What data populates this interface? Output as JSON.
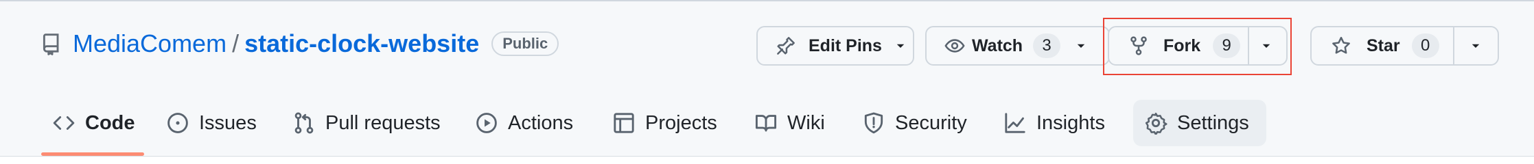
{
  "repo": {
    "owner": "MediaComem",
    "separator": "/",
    "name": "static-clock-website",
    "visibility": "Public",
    "icon": "repo-icon"
  },
  "actions": {
    "edit_pins": {
      "label": "Edit Pins",
      "icon": "pin-icon"
    },
    "watch": {
      "label": "Watch",
      "count": "3",
      "icon": "eye-icon"
    },
    "fork": {
      "label": "Fork",
      "count": "9",
      "icon": "fork-icon"
    },
    "star": {
      "label": "Star",
      "count": "0",
      "icon": "star-icon"
    }
  },
  "nav": {
    "items": [
      {
        "label": "Code",
        "icon": "code-icon",
        "selected": true
      },
      {
        "label": "Issues",
        "icon": "issue-opened-icon"
      },
      {
        "label": "Pull requests",
        "icon": "git-pull-request-icon"
      },
      {
        "label": "Actions",
        "icon": "play-icon"
      },
      {
        "label": "Projects",
        "icon": "table-icon"
      },
      {
        "label": "Wiki",
        "icon": "book-icon"
      },
      {
        "label": "Security",
        "icon": "shield-icon"
      },
      {
        "label": "Insights",
        "icon": "graph-icon"
      },
      {
        "label": "Settings",
        "icon": "gear-icon"
      }
    ]
  },
  "colors": {
    "link": "#0969da",
    "selected_underline": "#fd8c73",
    "highlight": "#ea4335",
    "border": "#d0d7de"
  }
}
